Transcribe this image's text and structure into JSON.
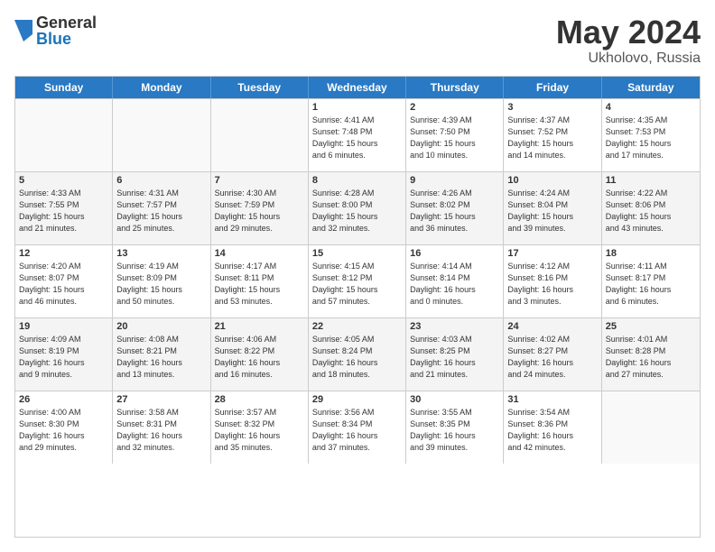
{
  "logo": {
    "general": "General",
    "blue": "Blue"
  },
  "title": "May 2024",
  "location": "Ukholovo, Russia",
  "days_of_week": [
    "Sunday",
    "Monday",
    "Tuesday",
    "Wednesday",
    "Thursday",
    "Friday",
    "Saturday"
  ],
  "weeks": [
    [
      {
        "day": "",
        "info": "",
        "empty": true
      },
      {
        "day": "",
        "info": "",
        "empty": true
      },
      {
        "day": "",
        "info": "",
        "empty": true
      },
      {
        "day": "1",
        "info": "Sunrise: 4:41 AM\nSunset: 7:48 PM\nDaylight: 15 hours\nand 6 minutes.",
        "empty": false
      },
      {
        "day": "2",
        "info": "Sunrise: 4:39 AM\nSunset: 7:50 PM\nDaylight: 15 hours\nand 10 minutes.",
        "empty": false
      },
      {
        "day": "3",
        "info": "Sunrise: 4:37 AM\nSunset: 7:52 PM\nDaylight: 15 hours\nand 14 minutes.",
        "empty": false
      },
      {
        "day": "4",
        "info": "Sunrise: 4:35 AM\nSunset: 7:53 PM\nDaylight: 15 hours\nand 17 minutes.",
        "empty": false
      }
    ],
    [
      {
        "day": "5",
        "info": "Sunrise: 4:33 AM\nSunset: 7:55 PM\nDaylight: 15 hours\nand 21 minutes.",
        "empty": false
      },
      {
        "day": "6",
        "info": "Sunrise: 4:31 AM\nSunset: 7:57 PM\nDaylight: 15 hours\nand 25 minutes.",
        "empty": false
      },
      {
        "day": "7",
        "info": "Sunrise: 4:30 AM\nSunset: 7:59 PM\nDaylight: 15 hours\nand 29 minutes.",
        "empty": false
      },
      {
        "day": "8",
        "info": "Sunrise: 4:28 AM\nSunset: 8:00 PM\nDaylight: 15 hours\nand 32 minutes.",
        "empty": false
      },
      {
        "day": "9",
        "info": "Sunrise: 4:26 AM\nSunset: 8:02 PM\nDaylight: 15 hours\nand 36 minutes.",
        "empty": false
      },
      {
        "day": "10",
        "info": "Sunrise: 4:24 AM\nSunset: 8:04 PM\nDaylight: 15 hours\nand 39 minutes.",
        "empty": false
      },
      {
        "day": "11",
        "info": "Sunrise: 4:22 AM\nSunset: 8:06 PM\nDaylight: 15 hours\nand 43 minutes.",
        "empty": false
      }
    ],
    [
      {
        "day": "12",
        "info": "Sunrise: 4:20 AM\nSunset: 8:07 PM\nDaylight: 15 hours\nand 46 minutes.",
        "empty": false
      },
      {
        "day": "13",
        "info": "Sunrise: 4:19 AM\nSunset: 8:09 PM\nDaylight: 15 hours\nand 50 minutes.",
        "empty": false
      },
      {
        "day": "14",
        "info": "Sunrise: 4:17 AM\nSunset: 8:11 PM\nDaylight: 15 hours\nand 53 minutes.",
        "empty": false
      },
      {
        "day": "15",
        "info": "Sunrise: 4:15 AM\nSunset: 8:12 PM\nDaylight: 15 hours\nand 57 minutes.",
        "empty": false
      },
      {
        "day": "16",
        "info": "Sunrise: 4:14 AM\nSunset: 8:14 PM\nDaylight: 16 hours\nand 0 minutes.",
        "empty": false
      },
      {
        "day": "17",
        "info": "Sunrise: 4:12 AM\nSunset: 8:16 PM\nDaylight: 16 hours\nand 3 minutes.",
        "empty": false
      },
      {
        "day": "18",
        "info": "Sunrise: 4:11 AM\nSunset: 8:17 PM\nDaylight: 16 hours\nand 6 minutes.",
        "empty": false
      }
    ],
    [
      {
        "day": "19",
        "info": "Sunrise: 4:09 AM\nSunset: 8:19 PM\nDaylight: 16 hours\nand 9 minutes.",
        "empty": false
      },
      {
        "day": "20",
        "info": "Sunrise: 4:08 AM\nSunset: 8:21 PM\nDaylight: 16 hours\nand 13 minutes.",
        "empty": false
      },
      {
        "day": "21",
        "info": "Sunrise: 4:06 AM\nSunset: 8:22 PM\nDaylight: 16 hours\nand 16 minutes.",
        "empty": false
      },
      {
        "day": "22",
        "info": "Sunrise: 4:05 AM\nSunset: 8:24 PM\nDaylight: 16 hours\nand 18 minutes.",
        "empty": false
      },
      {
        "day": "23",
        "info": "Sunrise: 4:03 AM\nSunset: 8:25 PM\nDaylight: 16 hours\nand 21 minutes.",
        "empty": false
      },
      {
        "day": "24",
        "info": "Sunrise: 4:02 AM\nSunset: 8:27 PM\nDaylight: 16 hours\nand 24 minutes.",
        "empty": false
      },
      {
        "day": "25",
        "info": "Sunrise: 4:01 AM\nSunset: 8:28 PM\nDaylight: 16 hours\nand 27 minutes.",
        "empty": false
      }
    ],
    [
      {
        "day": "26",
        "info": "Sunrise: 4:00 AM\nSunset: 8:30 PM\nDaylight: 16 hours\nand 29 minutes.",
        "empty": false
      },
      {
        "day": "27",
        "info": "Sunrise: 3:58 AM\nSunset: 8:31 PM\nDaylight: 16 hours\nand 32 minutes.",
        "empty": false
      },
      {
        "day": "28",
        "info": "Sunrise: 3:57 AM\nSunset: 8:32 PM\nDaylight: 16 hours\nand 35 minutes.",
        "empty": false
      },
      {
        "day": "29",
        "info": "Sunrise: 3:56 AM\nSunset: 8:34 PM\nDaylight: 16 hours\nand 37 minutes.",
        "empty": false
      },
      {
        "day": "30",
        "info": "Sunrise: 3:55 AM\nSunset: 8:35 PM\nDaylight: 16 hours\nand 39 minutes.",
        "empty": false
      },
      {
        "day": "31",
        "info": "Sunrise: 3:54 AM\nSunset: 8:36 PM\nDaylight: 16 hours\nand 42 minutes.",
        "empty": false
      },
      {
        "day": "",
        "info": "",
        "empty": true
      }
    ]
  ]
}
